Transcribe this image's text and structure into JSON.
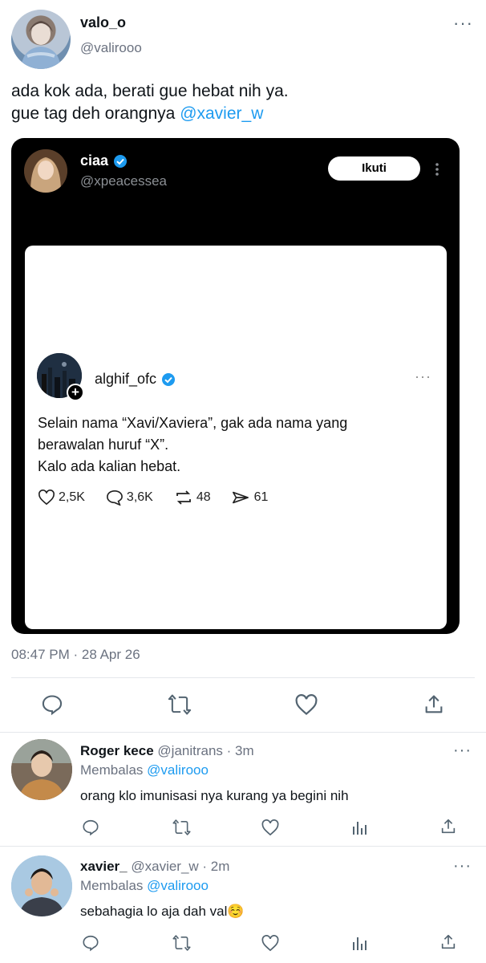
{
  "main_tweet": {
    "display_name": "valo_o",
    "handle": "@valirooo",
    "text_line1": "ada kok ada, berati gue hebat nih ya.",
    "text_line2_prefix": "gue tag deh orangnya ",
    "mention": "@xavier_w",
    "timestamp": "08:47 PM · 28 Apr 26"
  },
  "embedded": {
    "display_name": "ciaa",
    "handle": "@xpeacessea",
    "follow_label": "Ikuti",
    "inner_post": {
      "username": "alghif_ofc",
      "line1": "Selain nama “Xavi/Xaviera”, gak ada nama yang",
      "line2": "berawalan huruf “X”.",
      "line3": "Kalo ada kalian hebat.",
      "likes": "2,5K",
      "comments": "3,6K",
      "reposts": "48",
      "shares": "61"
    }
  },
  "replies": [
    {
      "display_name": "Roger kece",
      "handle_time": "@janitrans · 3m",
      "replying_prefix": "Membalas ",
      "replying_to": "@valirooo",
      "text": "orang klo imunisasi nya kurang ya begini nih"
    },
    {
      "display_name": "xavier_",
      "handle_time": "@xavier_w · 2m",
      "replying_prefix": "Membalas ",
      "replying_to": "@valirooo",
      "text": "sebahagia lo aja dah val",
      "emoji": "☺️"
    }
  ],
  "colors": {
    "link": "#1d9bf0",
    "verified": "#1d9bf0"
  }
}
